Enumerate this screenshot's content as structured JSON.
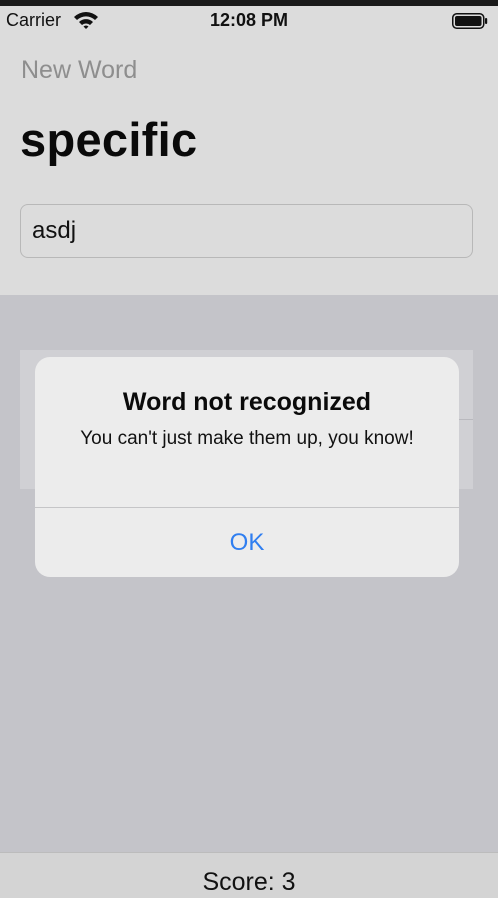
{
  "status_bar": {
    "carrier": "Carrier",
    "time": "12:08 PM",
    "wifi_icon": "wifi-icon",
    "battery_icon": "battery-icon"
  },
  "nav": {
    "new_word_label": "New Word"
  },
  "game": {
    "root_word": "specific",
    "input_value": "asdj"
  },
  "alert": {
    "title": "Word not recognized",
    "message": "You can't just make them up, you know!",
    "ok_label": "OK"
  },
  "toolbar": {
    "score_text": "Score: 3"
  },
  "colors": {
    "accent": "#2f7ef0",
    "dim_background": "#c4c4c9",
    "alert_background": "#ececec"
  }
}
